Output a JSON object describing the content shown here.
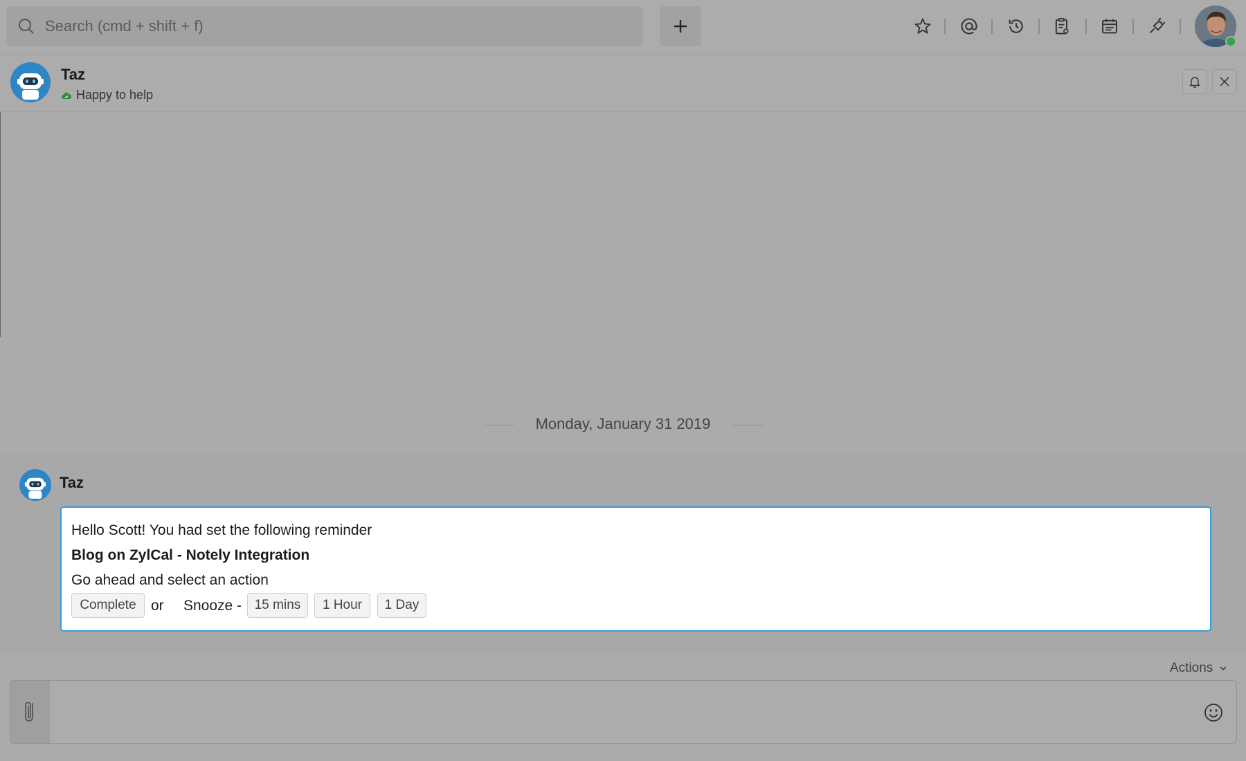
{
  "search": {
    "placeholder": "Search (cmd + shift + f)",
    "icon": "search-icon"
  },
  "toolbar": {
    "new_icon": "plus-icon",
    "icons": [
      "star-icon",
      "at-mention-icon",
      "history-icon",
      "clipboard-icon",
      "calendar-icon",
      "plug-icon"
    ],
    "online_color": "#2fa44a"
  },
  "chat_header": {
    "name": "Taz",
    "status": "Happy to help",
    "status_color": "#2a8c3d",
    "buttons": [
      "bell-icon",
      "close-icon"
    ]
  },
  "conversation": {
    "date": "Monday, January 31 2019",
    "sender": "Taz",
    "message": {
      "greeting": "Hello Scott! You had set the following reminder",
      "reminder_title": "Blog on ZylCal - Notely Integration",
      "prompt": "Go ahead and select an action",
      "complete_label": "Complete",
      "or_text": "or",
      "snooze_label": "Snooze -",
      "snooze_options": [
        "15 mins",
        "1 Hour",
        "1 Day"
      ]
    },
    "accent_color": "#3a9bd6"
  },
  "compose": {
    "actions_label": "Actions",
    "attach_icon": "paperclip-icon",
    "emoji_icon": "emoji-icon"
  }
}
